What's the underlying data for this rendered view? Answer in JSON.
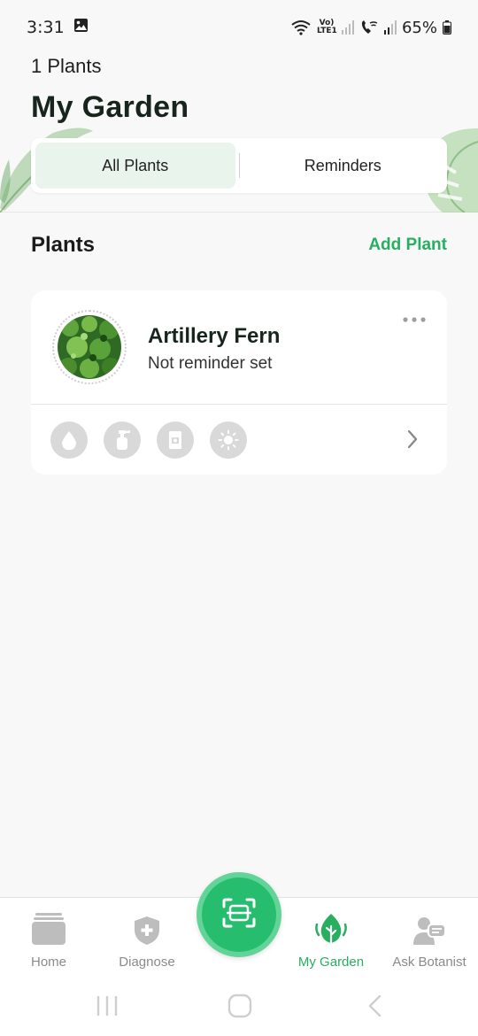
{
  "status_bar": {
    "time": "3:31",
    "battery": "65%",
    "network_label": "Vo) LTE1"
  },
  "header": {
    "count": "1 Plants",
    "title": "My Garden"
  },
  "tabs": [
    {
      "label": "All Plants",
      "active": true
    },
    {
      "label": "Reminders",
      "active": false
    }
  ],
  "section": {
    "title": "Plants",
    "add_label": "Add Plant"
  },
  "plants": [
    {
      "name": "Artillery Fern",
      "reminder": "Not reminder set",
      "care_icons": [
        "water-drop-icon",
        "spray-bottle-icon",
        "fertilizer-icon",
        "sun-icon"
      ]
    }
  ],
  "bottom_nav": {
    "items": [
      {
        "label": "Home",
        "icon": "home-icon",
        "active": false
      },
      {
        "label": "Diagnose",
        "icon": "shield-plus-icon",
        "active": false
      },
      {
        "label": "My Garden",
        "icon": "plant-icon",
        "active": true
      },
      {
        "label": "Ask Botanist",
        "icon": "botanist-chat-icon",
        "active": false
      }
    ],
    "scan_icon": "scan-icon"
  },
  "colors": {
    "accent": "#27ae60",
    "tab_active_bg": "#e9f4ec",
    "card_bg": "#ffffff",
    "page_bg": "#f8f8f8"
  }
}
